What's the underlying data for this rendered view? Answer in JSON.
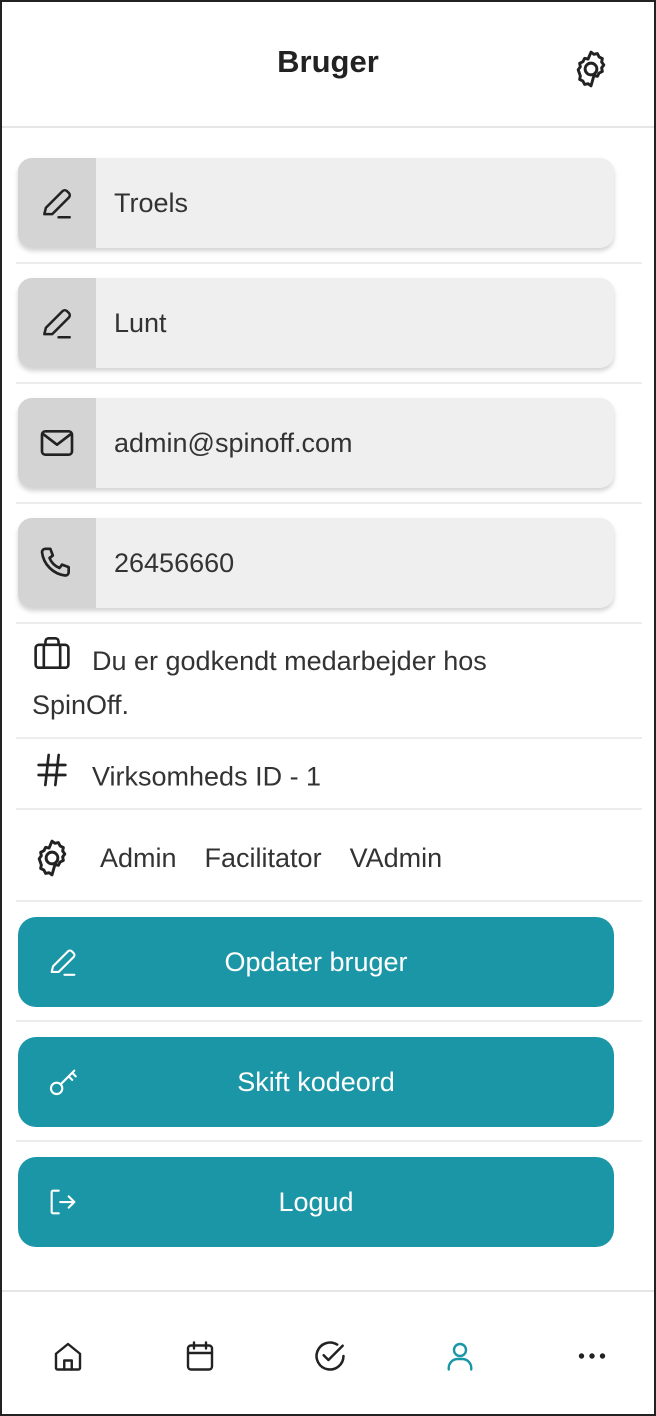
{
  "header": {
    "title": "Bruger",
    "settings_icon": "gear-icon"
  },
  "fields": {
    "first_name": {
      "value": "Troels",
      "icon": "pencil-icon"
    },
    "last_name": {
      "value": "Lunt",
      "icon": "pencil-icon"
    },
    "email": {
      "value": "admin@spinoff.com",
      "icon": "mail-icon"
    },
    "phone": {
      "value": "26456660",
      "icon": "phone-icon"
    }
  },
  "employment": {
    "text": "Du er godkendt medarbejder hos SpinOff.",
    "icon": "briefcase-icon"
  },
  "company": {
    "text": "Virksomheds ID - 1",
    "icon": "hash-icon"
  },
  "roles": {
    "icon": "gear-icon",
    "items": [
      "Admin",
      "Facilitator",
      "VAdmin"
    ]
  },
  "actions": {
    "update": {
      "label": "Opdater bruger",
      "icon": "pencil-icon"
    },
    "change_password": {
      "label": "Skift kodeord",
      "icon": "key-icon"
    },
    "logout": {
      "label": "Logud",
      "icon": "logout-icon"
    }
  },
  "nav": {
    "items": [
      "home-icon",
      "calendar-icon",
      "check-circle-icon",
      "user-icon",
      "more-icon"
    ],
    "active": "user-icon"
  },
  "colors": {
    "accent": "#1b96a6",
    "field_bg": "#efefef",
    "icon_bg": "#d4d4d4",
    "text": "#333333"
  }
}
